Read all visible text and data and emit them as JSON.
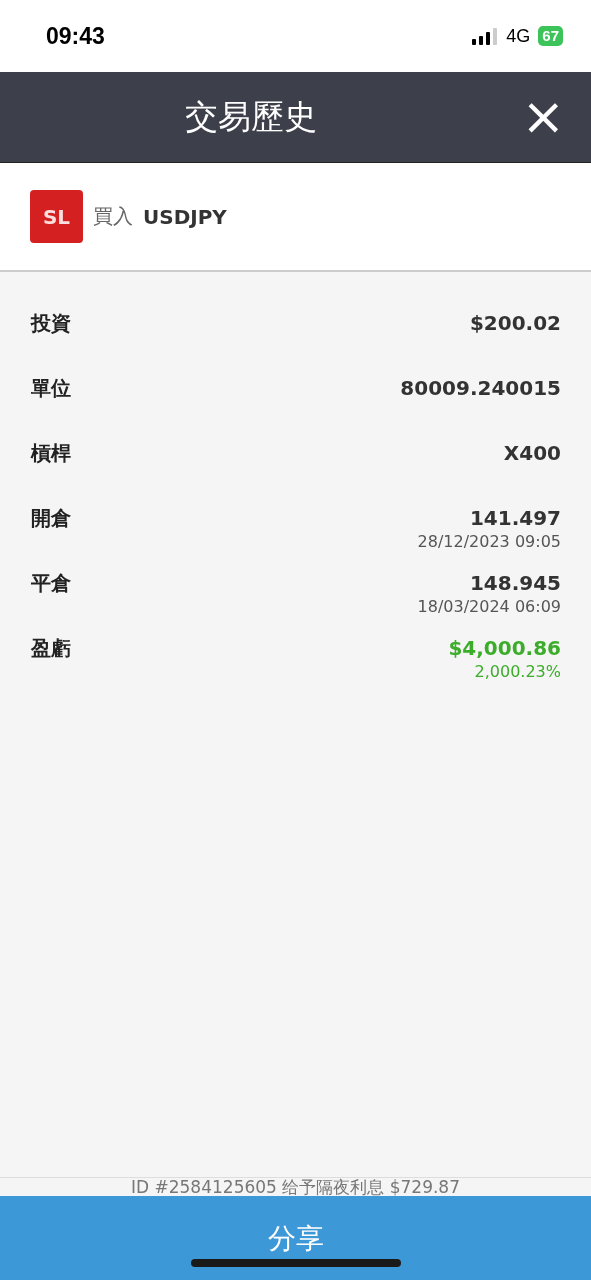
{
  "status_bar": {
    "time": "09:43",
    "network": "4G",
    "battery": "67"
  },
  "header": {
    "title": "交易歷史",
    "close": "×"
  },
  "trade": {
    "badge": "SL",
    "action": "買入",
    "symbol": "USDJPY"
  },
  "details": [
    {
      "kind": "plain",
      "label": "投資",
      "value": "$200.02"
    },
    {
      "kind": "plain",
      "label": "單位",
      "value": "80009.240015"
    },
    {
      "kind": "plain",
      "label": "槓桿",
      "value": "X400"
    },
    {
      "kind": "plain",
      "label": "開倉",
      "value": "141.497",
      "sub": "28/12/2023 09:05"
    },
    {
      "kind": "plain",
      "label": "平倉",
      "value": "148.945",
      "sub": "18/03/2024 06:09"
    },
    {
      "kind": "profit",
      "label": "盈虧",
      "value": "$4,000.86",
      "sub": "2,000.23%"
    }
  ],
  "footer_note": "ID #2584125605 给予隔夜利息 $729.87",
  "share_button": "分享"
}
